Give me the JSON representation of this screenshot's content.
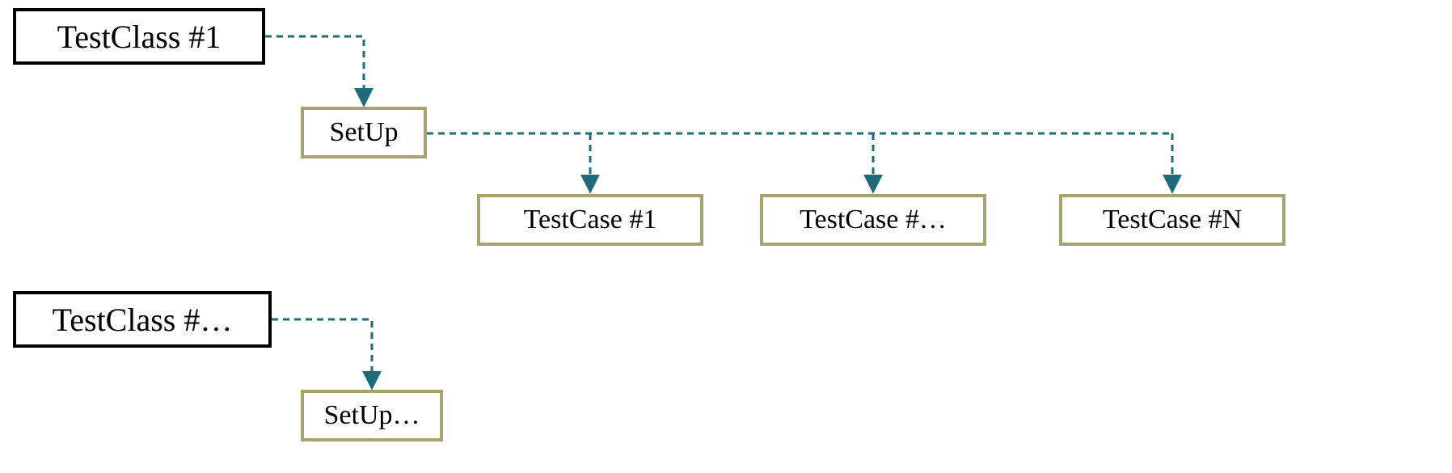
{
  "diagram": {
    "type": "hierarchy",
    "description": "Test class hierarchy showing TestClass nodes branching to SetUp nodes branching to TestCase nodes",
    "colors": {
      "testclass_border": "#000000",
      "setup_testcase_border": "#a8a272",
      "connector": "#1f6b7a"
    },
    "nodes": {
      "testclass1": {
        "label": "TestClass #1"
      },
      "testclass2": {
        "label": "TestClass #…"
      },
      "setup1": {
        "label": "SetUp"
      },
      "setup2": {
        "label": "SetUp…"
      },
      "testcase1": {
        "label": "TestCase #1"
      },
      "testcase2": {
        "label": "TestCase #…"
      },
      "testcase3": {
        "label": "TestCase #N"
      }
    },
    "edges": [
      {
        "from": "testclass1",
        "to": "setup1"
      },
      {
        "from": "setup1",
        "to": "testcase1"
      },
      {
        "from": "setup1",
        "to": "testcase2"
      },
      {
        "from": "setup1",
        "to": "testcase3"
      },
      {
        "from": "testclass2",
        "to": "setup2"
      }
    ]
  }
}
